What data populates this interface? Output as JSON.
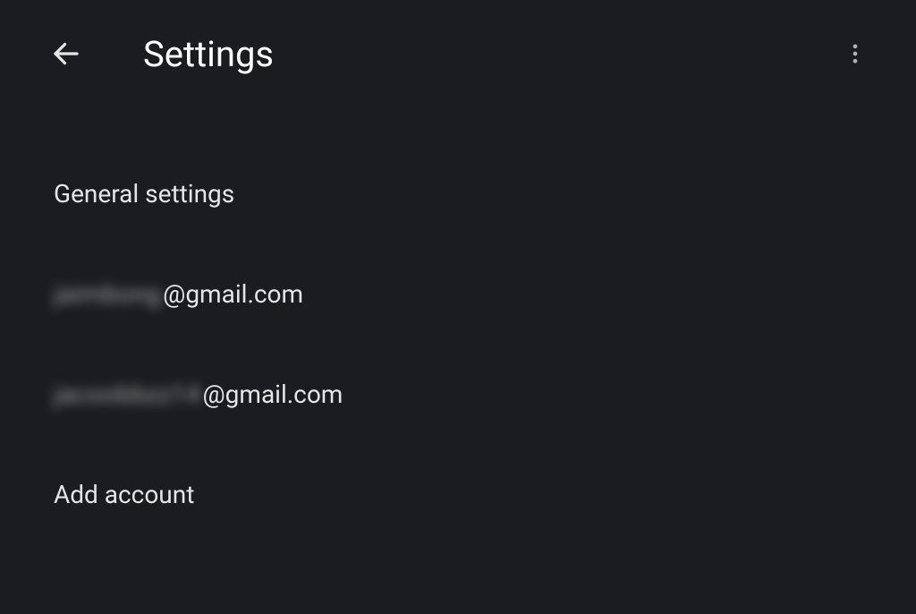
{
  "header": {
    "title": "Settings"
  },
  "items": {
    "general": "General settings",
    "account1": {
      "local": "jaimbong",
      "domain": "@gmail.com"
    },
    "account2": {
      "local": "jacoobbzz14",
      "domain": "@gmail.com"
    },
    "add_account": "Add account"
  }
}
